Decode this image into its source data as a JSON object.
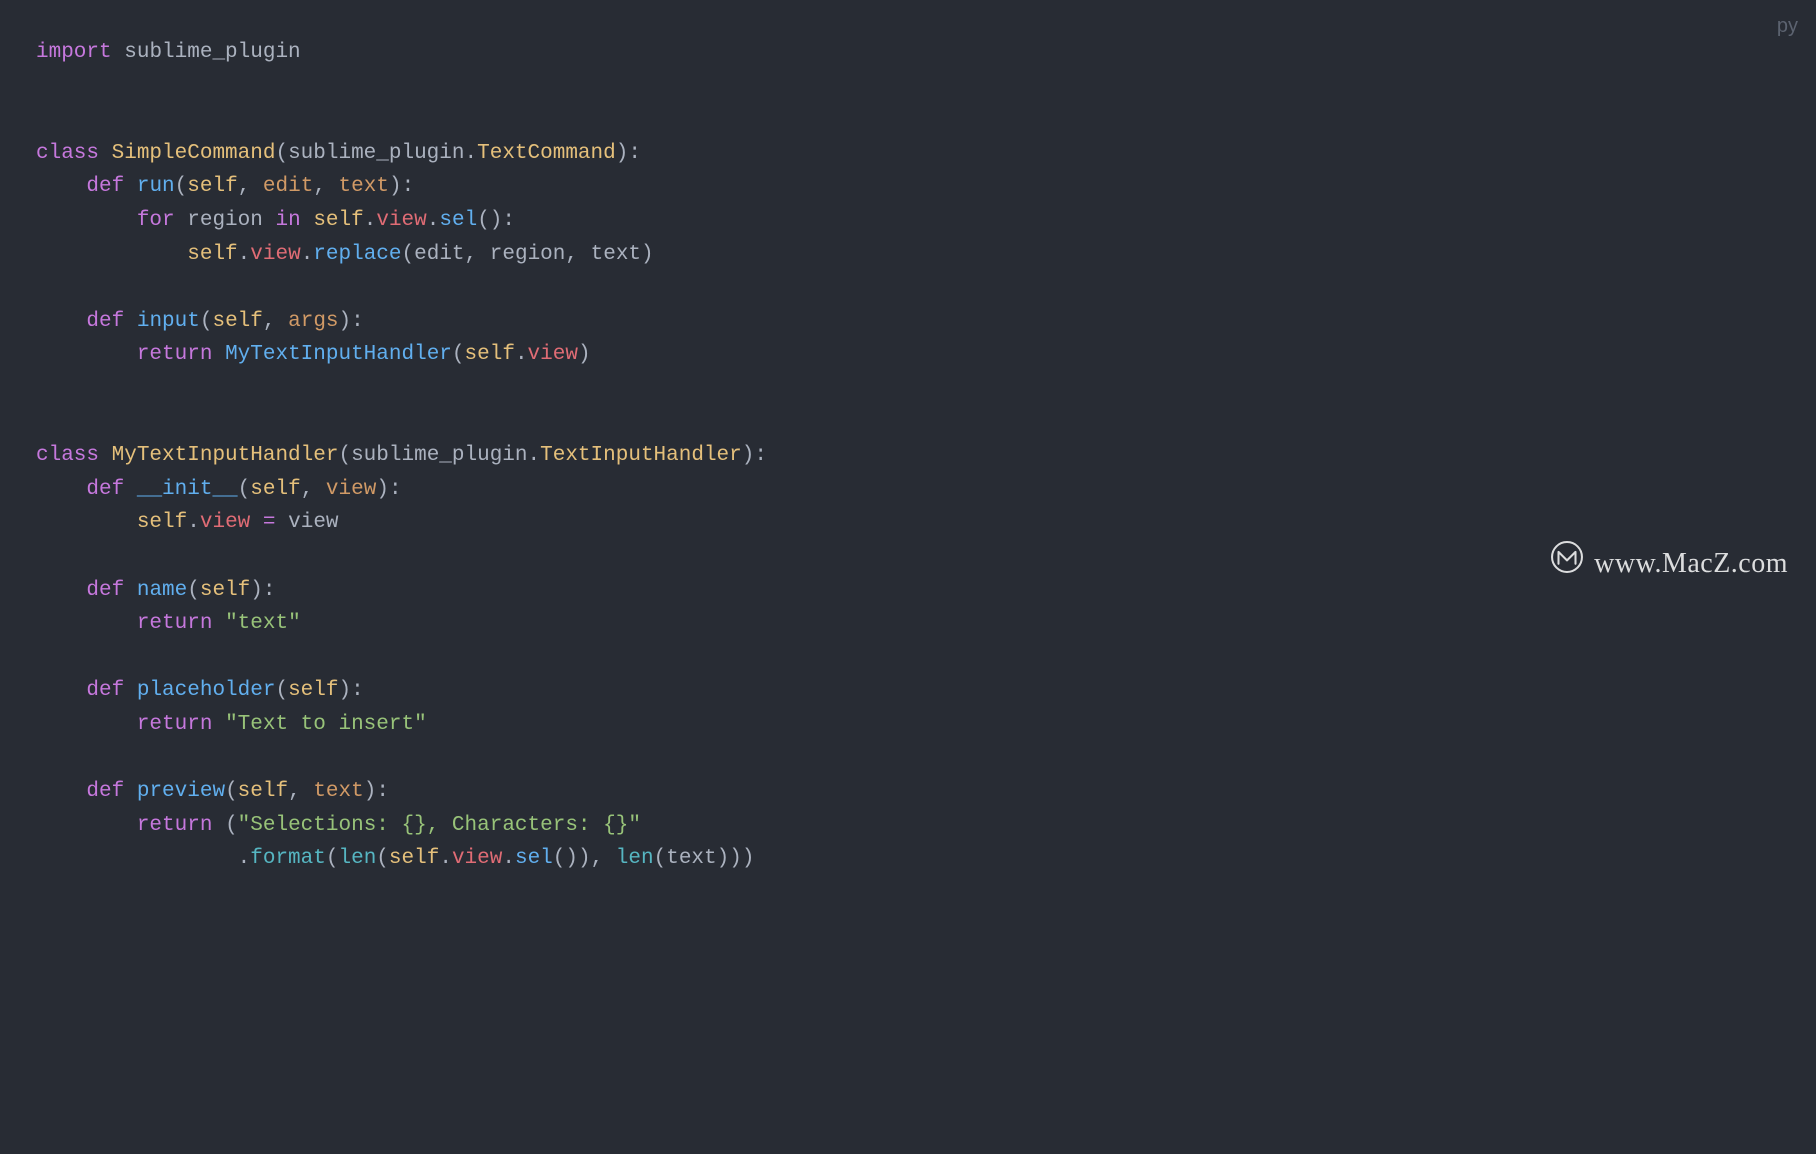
{
  "lang_badge": "py",
  "watermark": "www.MacZ.com",
  "t": {
    "import": "import",
    "class": "class",
    "def": "def",
    "for": "for",
    "in": "in",
    "return": "return",
    "sublime_plugin": "sublime_plugin",
    "SimpleCommand": "SimpleCommand",
    "TextCommand": "TextCommand",
    "run": "run",
    "self": "self",
    "edit": "edit",
    "text": "text",
    "region": "region",
    "view": "view",
    "sel": "sel",
    "replace": "replace",
    "input": "input",
    "args": "args",
    "MyTextInputHandler": "MyTextInputHandler",
    "TextInputHandler": "TextInputHandler",
    "dinit": "__init__",
    "name": "name",
    "placeholder": "placeholder",
    "preview": "preview",
    "format": "format",
    "len": "len",
    "str_text": "\"text\"",
    "str_placeholder": "\"Text to insert\"",
    "str_preview": "\"Selections: {}, Characters: {}\""
  }
}
